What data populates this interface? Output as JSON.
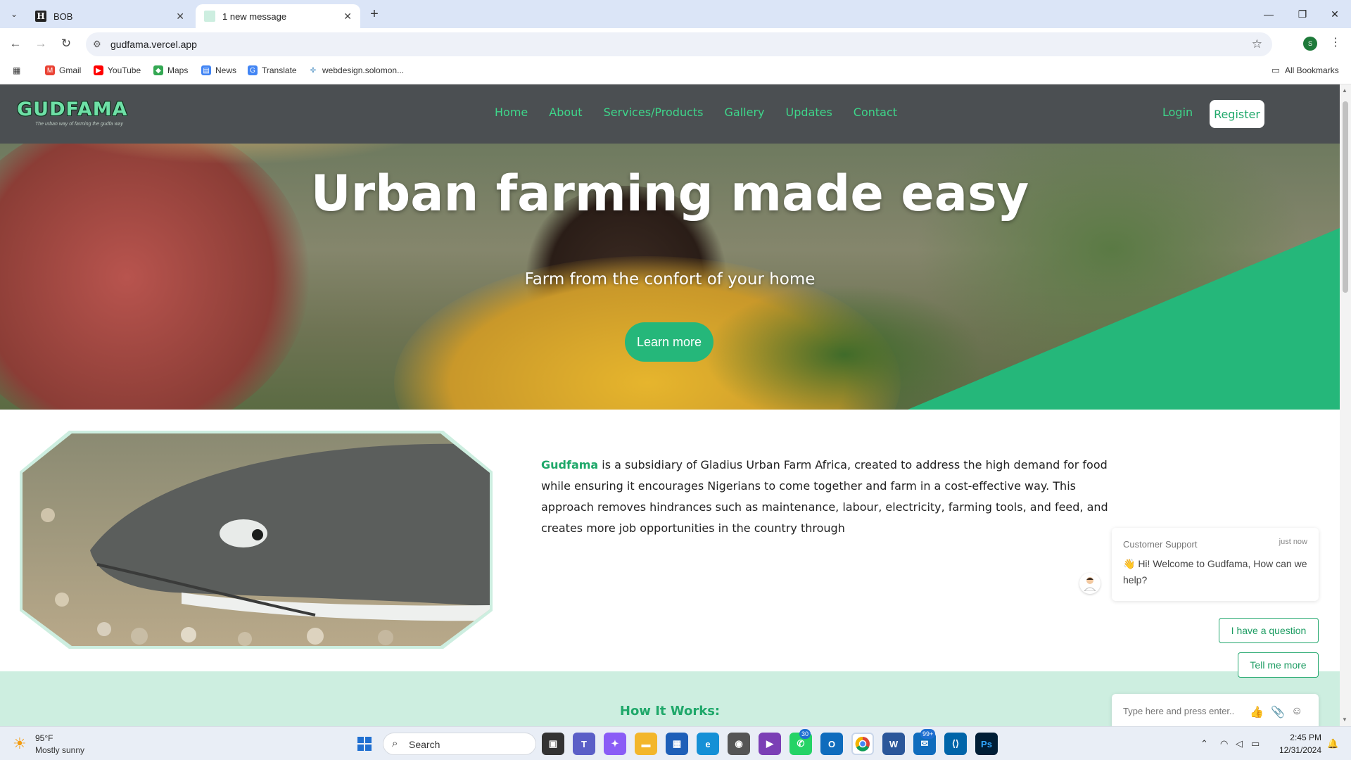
{
  "browser": {
    "tabs": [
      {
        "title": "BOB",
        "favicon": "H",
        "active": false
      },
      {
        "title": "1 new message",
        "favicon": "gudfama-favicon",
        "active": true
      }
    ],
    "url": "gudfama.vercel.app",
    "profile_initial": "S",
    "bookmarks": [
      {
        "label": "Gmail",
        "icon": "gmail-icon"
      },
      {
        "label": "YouTube",
        "icon": "youtube-icon"
      },
      {
        "label": "Maps",
        "icon": "maps-icon"
      },
      {
        "label": "News",
        "icon": "news-icon"
      },
      {
        "label": "Translate",
        "icon": "translate-icon"
      },
      {
        "label": "webdesign.solomon...",
        "icon": "webdesign-icon"
      }
    ],
    "all_bookmarks": "All Bookmarks"
  },
  "site": {
    "logo": "GUDFAMA",
    "tagline": "The urban way of farming the gudfa way",
    "nav": [
      "Home",
      "About",
      "Services/Products",
      "Gallery",
      "Updates",
      "Contact"
    ],
    "login": "Login",
    "register": "Register",
    "accent": "#25b77a",
    "nav_bg": "#4b4f52"
  },
  "hero": {
    "title": "Urban farming made easy",
    "subtitle": "Farm from the confort of your home",
    "cta": "Learn more"
  },
  "about": {
    "brand": "Gudfama",
    "text": " is a subsidiary of Gladius Urban Farm Africa, created to address the high demand for food while ensuring it encourages Nigerians to come together and farm in a cost-effective way. This approach removes hindrances such as maintenance, labour, electricity, farming tools, and feed, and creates more job opportunities in the country through"
  },
  "how": {
    "title": "How It Works:"
  },
  "chat": {
    "from": "Customer Support",
    "time": "just now",
    "message": "👋 Hi! Welcome to Gudfama, How can we help?",
    "buttons": [
      "I have a question",
      "Tell me more"
    ],
    "input_placeholder": "Type here and press enter..",
    "unread": "1"
  },
  "taskbar": {
    "weather_temp": "95°F",
    "weather_desc": "Mostly sunny",
    "search": "Search",
    "whatsapp_badge": "30",
    "mail_badge": "99+",
    "time": "2:45 PM",
    "date": "12/31/2024"
  }
}
